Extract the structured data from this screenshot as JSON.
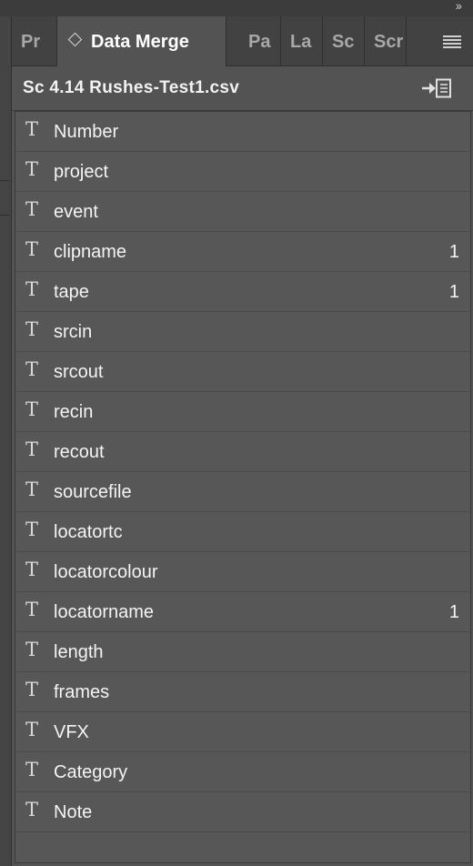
{
  "tabs": [
    {
      "label": "Pr",
      "active": false
    },
    {
      "label": "Data Merge",
      "active": true
    },
    {
      "label": "Pa",
      "active": false
    },
    {
      "label": "La",
      "active": false
    },
    {
      "label": "Sc",
      "active": false
    },
    {
      "label": "Scr",
      "active": false
    }
  ],
  "panel": {
    "source_file": "Sc 4.14 Rushes-Test1.csv"
  },
  "fields": [
    {
      "name": "Number",
      "count": ""
    },
    {
      "name": "project",
      "count": ""
    },
    {
      "name": "event",
      "count": ""
    },
    {
      "name": "clipname",
      "count": "1"
    },
    {
      "name": "tape",
      "count": "1"
    },
    {
      "name": "srcin",
      "count": ""
    },
    {
      "name": "srcout",
      "count": ""
    },
    {
      "name": "recin",
      "count": ""
    },
    {
      "name": "recout",
      "count": ""
    },
    {
      "name": "sourcefile",
      "count": ""
    },
    {
      "name": "locatortc",
      "count": ""
    },
    {
      "name": "locatorcolour",
      "count": ""
    },
    {
      "name": "locatorname",
      "count": "1"
    },
    {
      "name": "length",
      "count": ""
    },
    {
      "name": "frames",
      "count": ""
    },
    {
      "name": "VFX",
      "count": ""
    },
    {
      "name": "Category",
      "count": ""
    },
    {
      "name": "Note",
      "count": ""
    }
  ],
  "field_type_glyph": "T",
  "icons": {
    "collapse": "double-chevron-right-icon",
    "panel_menu": "hamburger-menu-icon",
    "select_source": "import-data-source-icon",
    "field_type": "text-field-icon"
  },
  "colors": {
    "panel_bg": "#535353",
    "tabbar_bg": "#424242",
    "list_bg": "#575757"
  }
}
